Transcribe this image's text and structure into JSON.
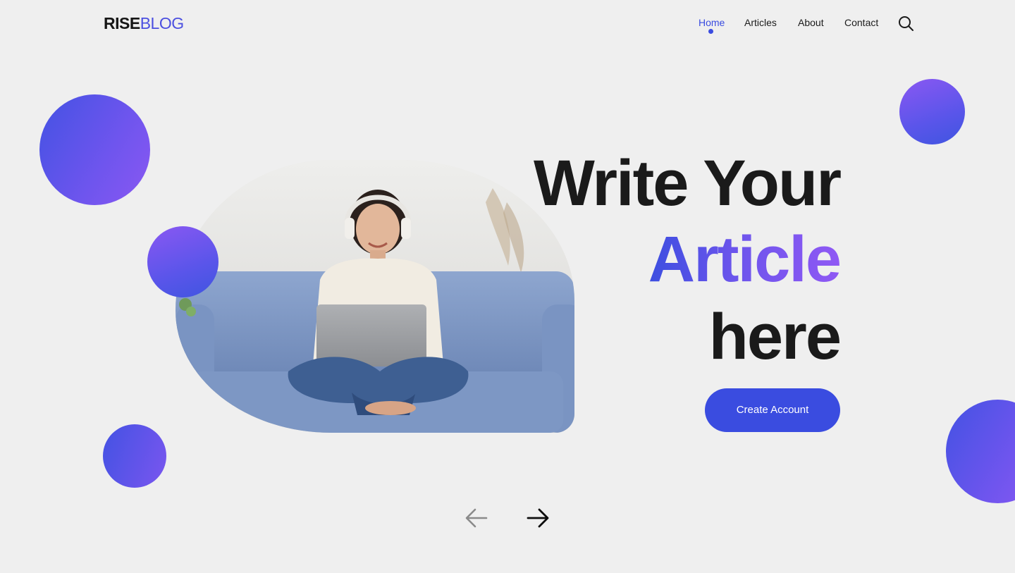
{
  "logo": {
    "part1": "RISE",
    "part2": "BLOG"
  },
  "nav": {
    "items": [
      {
        "label": "Home",
        "active": true
      },
      {
        "label": "Articles",
        "active": false
      },
      {
        "label": "About",
        "active": false
      },
      {
        "label": "Contact",
        "active": false
      }
    ],
    "search_icon": "search-icon"
  },
  "hero": {
    "line1": "Write Your",
    "line2": "Article",
    "line3": "here",
    "cta_label": "Create Account",
    "image": "woman-with-laptop-on-sofa-photo"
  },
  "carousel": {
    "prev_icon": "arrow-left-icon",
    "next_icon": "arrow-right-icon"
  },
  "colors": {
    "accent": "#3a4ce0",
    "gradient_start": "#4352e3",
    "gradient_end": "#8a58f2",
    "background": "#efefef",
    "text": "#1a1a1a"
  }
}
